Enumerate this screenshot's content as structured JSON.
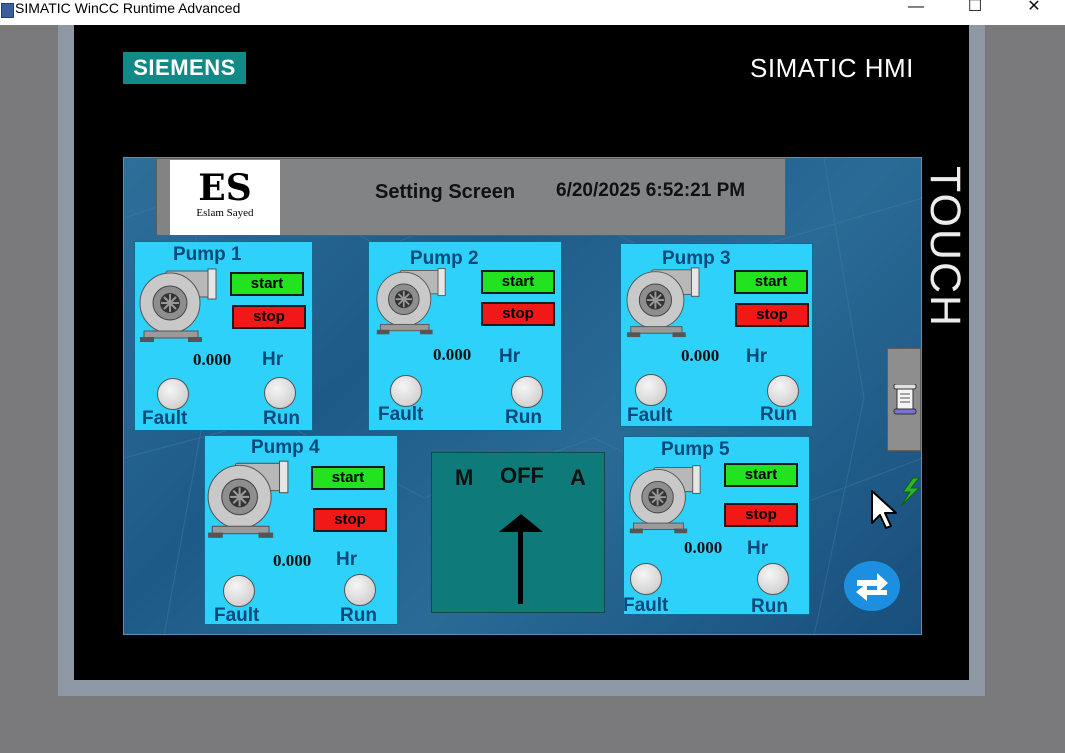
{
  "window": {
    "title": "SIMATIC WinCC Runtime Advanced",
    "minimize_glyph": "—",
    "maximize_glyph": "☐",
    "close_glyph": "✕"
  },
  "device": {
    "brand": "SIEMENS",
    "model": "SIMATIC HMI",
    "side_label": "TOUCH"
  },
  "header": {
    "logo_letters": "ES",
    "logo_name": "Eslam Sayed",
    "screen_title": "Setting Screen",
    "datetime": "6/20/2025 6:52:21 PM"
  },
  "pumps": [
    {
      "title": "Pump 1",
      "start_label": "start",
      "stop_label": "stop",
      "hours": "0.000",
      "hours_unit": "Hr",
      "fault_label": "Fault",
      "run_label": "Run"
    },
    {
      "title": "Pump 2",
      "start_label": "start",
      "stop_label": "stop",
      "hours": "0.000",
      "hours_unit": "Hr",
      "fault_label": "Fault",
      "run_label": "Run"
    },
    {
      "title": "Pump 3",
      "start_label": "start",
      "stop_label": "stop",
      "hours": "0.000",
      "hours_unit": "Hr",
      "fault_label": "Fault",
      "run_label": "Run"
    },
    {
      "title": "Pump 4",
      "start_label": "start",
      "stop_label": "stop",
      "hours": "0.000",
      "hours_unit": "Hr",
      "fault_label": "Fault",
      "run_label": "Run"
    },
    {
      "title": "Pump 5",
      "start_label": "start",
      "stop_label": "stop",
      "hours": "0.000",
      "hours_unit": "Hr",
      "fault_label": "Fault",
      "run_label": "Run"
    }
  ],
  "mode_selector": {
    "manual_label": "M",
    "off_label": "OFF",
    "auto_label": "A",
    "position": "OFF"
  },
  "colors": {
    "start_button": "#23e21f",
    "stop_button": "#f21818",
    "pump_panel": "#2ed1f9",
    "selector_panel": "#0e7b7a",
    "brand_logo": "#0f8a86"
  },
  "icons": {
    "side_button": "scroll-icon",
    "swap_button": "swap-arrows-icon",
    "connection": "lightning-icon",
    "cursor": "mouse-cursor-icon"
  }
}
